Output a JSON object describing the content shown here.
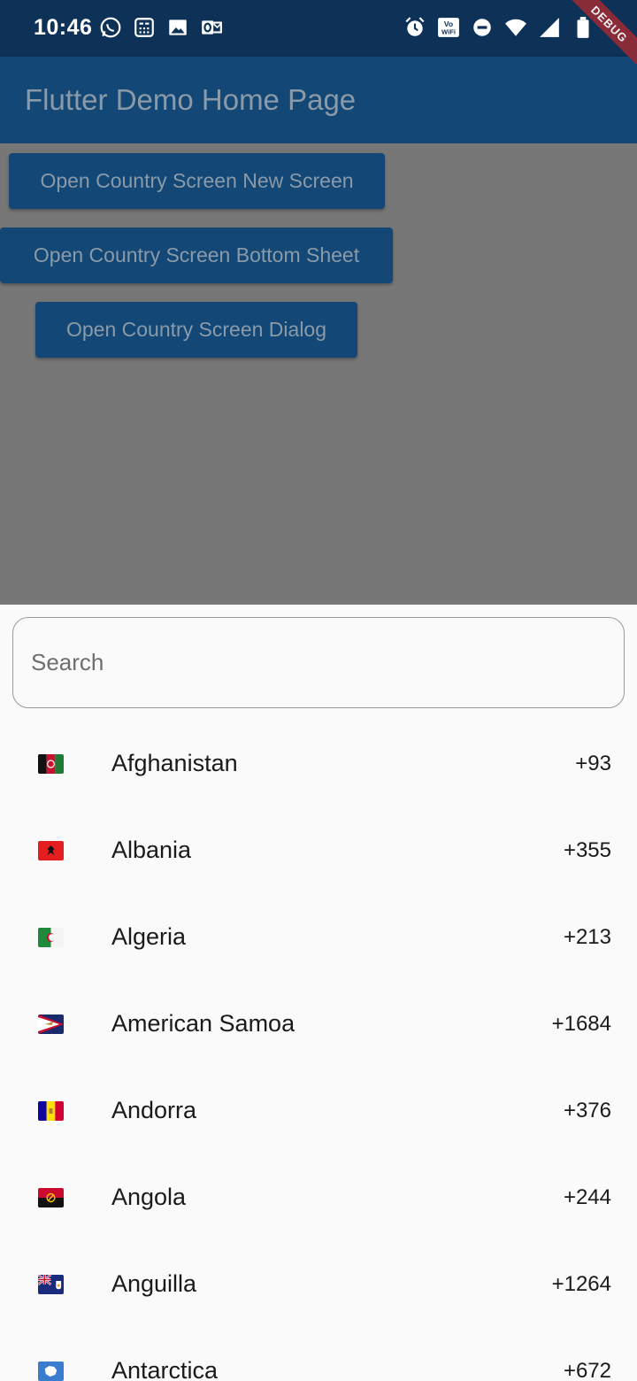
{
  "status_bar": {
    "time": "10:46",
    "left_icons": [
      "whatsapp-icon",
      "calculator-icon",
      "image-icon",
      "outlook-icon"
    ],
    "right_icons": [
      "alarm-icon",
      "volte-wifi-icon",
      "do-not-disturb-icon",
      "wifi-icon",
      "cell-signal-icon",
      "battery-icon"
    ]
  },
  "debug_banner": "DEBUG",
  "app_bar": {
    "title": "Flutter Demo Home Page"
  },
  "buttons": {
    "new_screen": "Open Country Screen New Screen",
    "bottom_sheet": "Open Country Screen Bottom Sheet",
    "dialog": "Open Country Screen Dialog"
  },
  "sheet": {
    "search_placeholder": "Search",
    "countries": [
      {
        "name": "Afghanistan",
        "code": "+93",
        "flag": "afghanistan-flag-icon"
      },
      {
        "name": "Albania",
        "code": "+355",
        "flag": "albania-flag-icon"
      },
      {
        "name": "Algeria",
        "code": "+213",
        "flag": "algeria-flag-icon"
      },
      {
        "name": "American Samoa",
        "code": "+1684",
        "flag": "american-samoa-flag-icon"
      },
      {
        "name": "Andorra",
        "code": "+376",
        "flag": "andorra-flag-icon"
      },
      {
        "name": "Angola",
        "code": "+244",
        "flag": "angola-flag-icon"
      },
      {
        "name": "Anguilla",
        "code": "+1264",
        "flag": "anguilla-flag-icon"
      },
      {
        "name": "Antarctica",
        "code": "+672",
        "flag": "antarctica-flag-icon"
      }
    ]
  },
  "colors": {
    "status_bar": "#0d3157",
    "app_bar": "#124776",
    "scrim_background": "#777777",
    "sheet_background": "#fafafa",
    "debug_banner": "#8a2b3a"
  }
}
